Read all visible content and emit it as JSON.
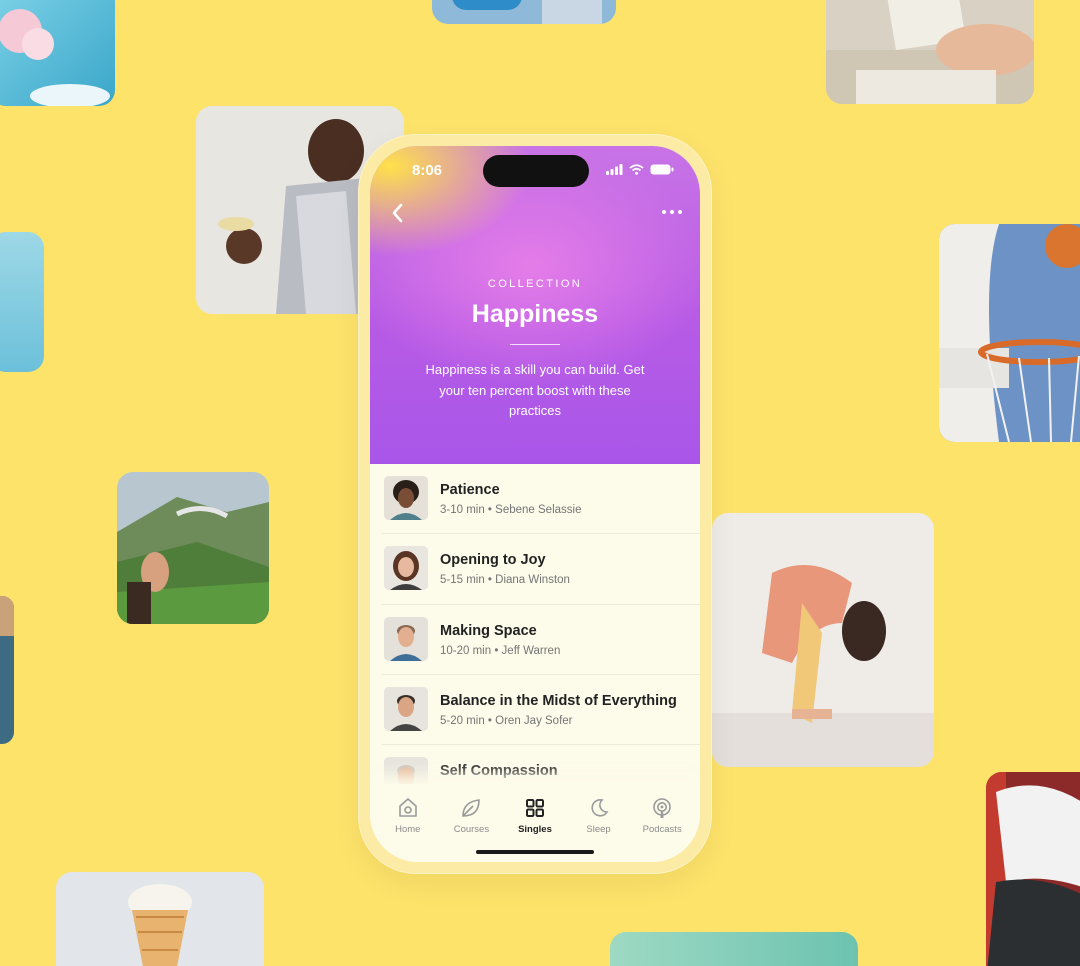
{
  "status_bar": {
    "time": "8:06"
  },
  "header": {
    "eyebrow": "COLLECTION",
    "title": "Happiness",
    "description": "Happiness is a skill you can build. Get your ten percent boost with these practices"
  },
  "items": [
    {
      "title": "Patience",
      "meta": "3-10 min  •  Sebene Selassie"
    },
    {
      "title": "Opening to Joy",
      "meta": "5-15 min  •  Diana Winston"
    },
    {
      "title": "Making Space",
      "meta": "10-20 min  •  Jeff Warren"
    },
    {
      "title": "Balance in the Midst of Everything",
      "meta": "5-20 min  •  Oren Jay Sofer"
    },
    {
      "title": "Self Compassion",
      "meta": ""
    }
  ],
  "tabs": [
    {
      "label": "Home",
      "icon": "home-icon"
    },
    {
      "label": "Courses",
      "icon": "leaf-icon"
    },
    {
      "label": "Singles",
      "icon": "grid-icon"
    },
    {
      "label": "Sleep",
      "icon": "moon-icon"
    },
    {
      "label": "Podcasts",
      "icon": "podcast-icon"
    }
  ],
  "active_tab": "Singles",
  "colors": {
    "background": "#FDE36A",
    "hero_purple": "#B75BE6",
    "list_bg": "#FDFBEA"
  }
}
